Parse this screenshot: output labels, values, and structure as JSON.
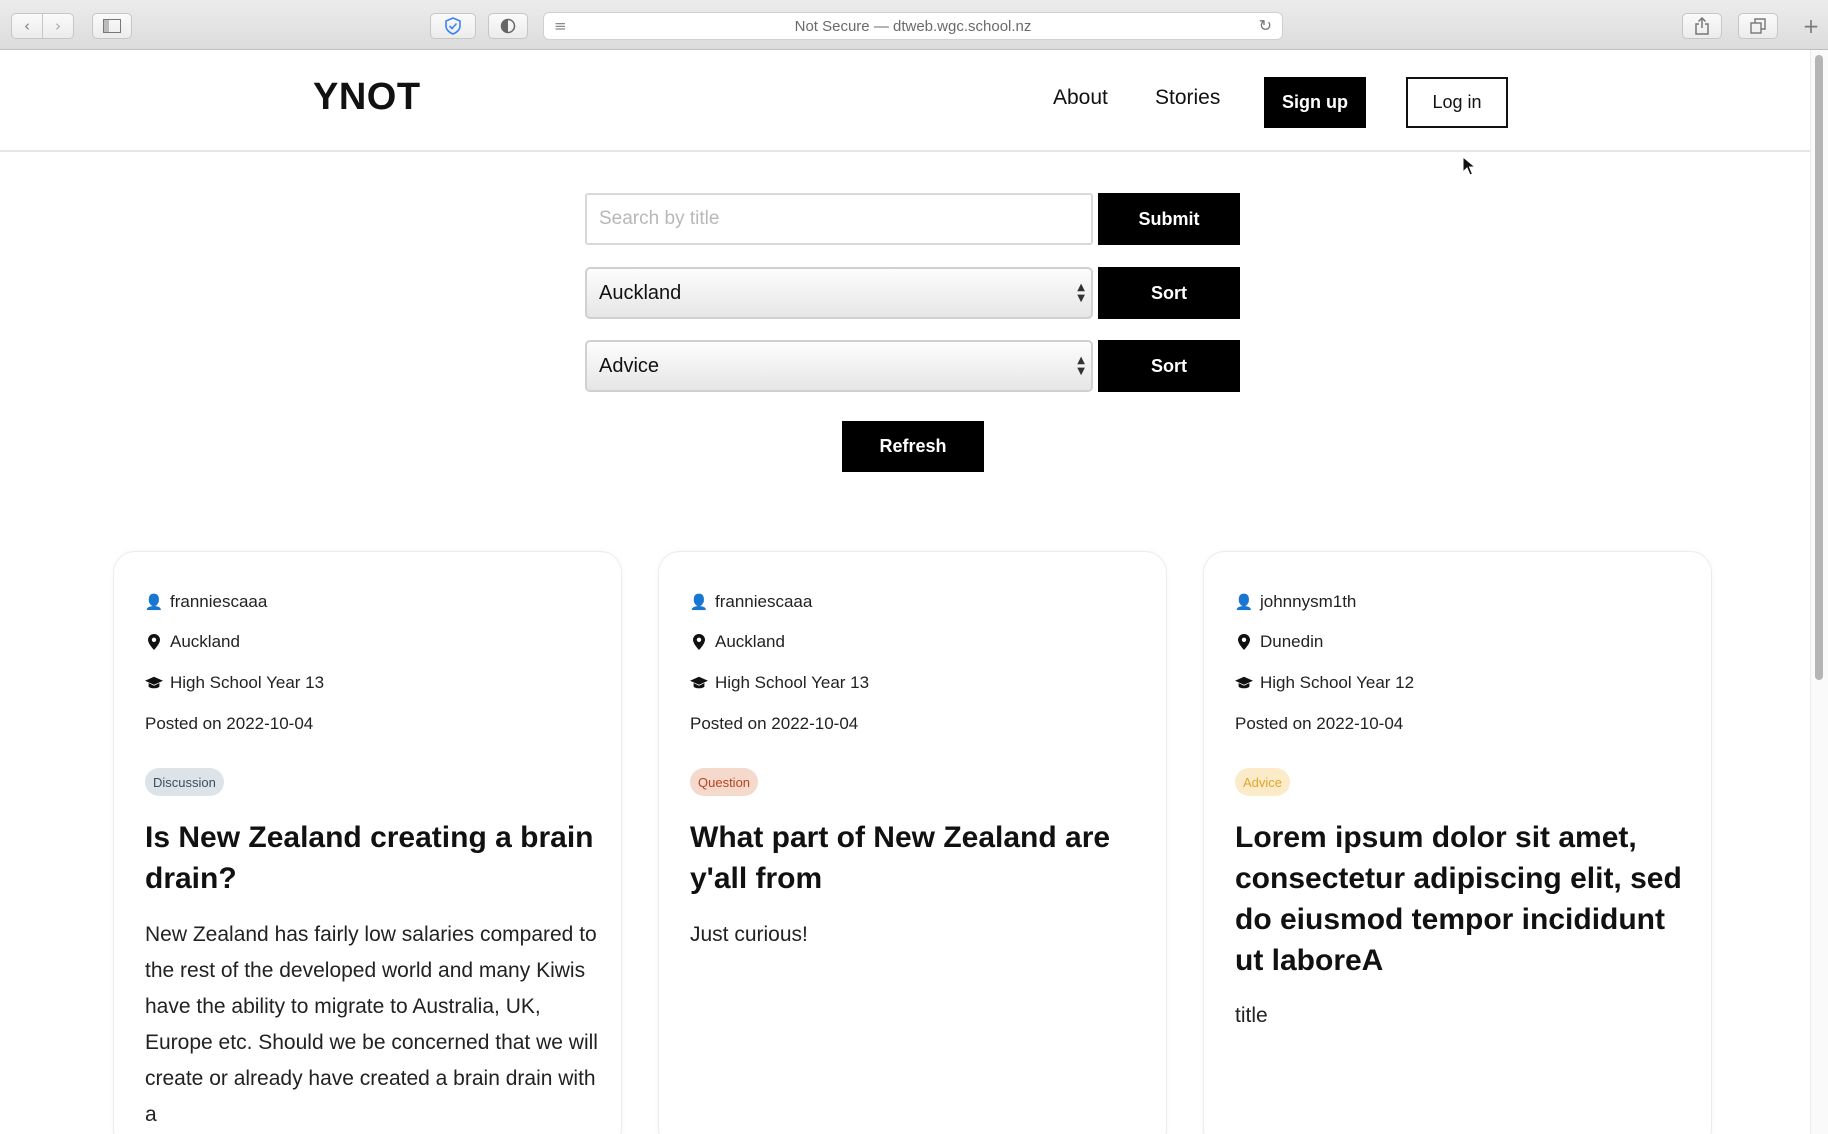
{
  "browser": {
    "url_text": "Not Secure — dtweb.wgc.school.nz",
    "icons": {
      "back": "chevron-left-icon",
      "forward": "chevron-right-icon",
      "sidebar": "sidebar-icon",
      "privacy": "shield-icon",
      "reader": "reader-icon",
      "reload": "reload-icon",
      "share": "share-icon",
      "tabs": "tabs-icon",
      "new_tab": "plus-icon"
    }
  },
  "header": {
    "logo": "YNOT",
    "nav": {
      "about": "About",
      "stories": "Stories"
    },
    "signup_label": "Sign up",
    "login_label": "Log in"
  },
  "filters": {
    "search_placeholder": "Search by title",
    "submit_label": "Submit",
    "location_value": "Auckland",
    "location_sort_label": "Sort",
    "category_value": "Advice",
    "category_sort_label": "Sort",
    "refresh_label": "Refresh"
  },
  "posts": [
    {
      "username": "franniescaaa",
      "location": "Auckland",
      "school": "High School Year 13",
      "posted": "Posted on 2022-10-04",
      "tag": "Discussion",
      "tag_bg": "#dce4ea",
      "tag_fg": "#3d4d5a",
      "title": "Is New Zealand creating a brain drain?",
      "body": "New Zealand has fairly low salaries compared to the rest of the developed world and many Kiwis have the ability to migrate to Australia, UK, Europe etc. Should we be concerned that we will create or already have created a brain drain with a"
    },
    {
      "username": "franniescaaa",
      "location": "Auckland",
      "school": "High School Year 13",
      "posted": "Posted on 2022-10-04",
      "tag": "Question",
      "tag_bg": "#f6d9cd",
      "tag_fg": "#b8431c",
      "title": "What part of New Zealand are y'all from",
      "body": "Just curious!"
    },
    {
      "username": "johnnysm1th",
      "location": "Dunedin",
      "school": "High School Year 12",
      "posted": "Posted on 2022-10-04",
      "tag": "Advice",
      "tag_bg": "#fcebc9",
      "tag_fg": "#e2a52b",
      "title": "Lorem ipsum dolor sit amet, consectetur adipiscing elit, sed do eiusmod tempor incididunt ut laboreA",
      "body": "title"
    }
  ]
}
